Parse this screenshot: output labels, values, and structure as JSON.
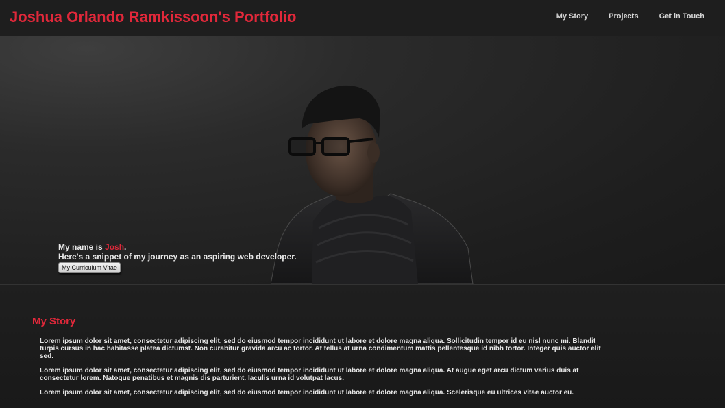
{
  "header": {
    "title": "Joshua Orlando Ramkissoon's Portfolio",
    "nav": [
      "My Story",
      "Projects",
      "Get in Touch"
    ]
  },
  "hero": {
    "intro_prefix": "My name is ",
    "intro_name": "Josh",
    "intro_suffix": ".",
    "tagline": "Here's a snippet of my journey as an aspiring web developer.",
    "cv_button": "My Curriculum Vitae"
  },
  "story": {
    "heading": "My Story",
    "paragraphs": [
      "Lorem ipsum dolor sit amet, consectetur adipiscing elit, sed do eiusmod tempor incididunt ut labore et dolore magna aliqua. Sollicitudin tempor id eu nisl nunc mi. Blandit turpis cursus in hac habitasse platea dictumst. Non curabitur gravida arcu ac tortor. At tellus at urna condimentum mattis pellentesque id nibh tortor. Integer quis auctor elit sed.",
      "Lorem ipsum dolor sit amet, consectetur adipiscing elit, sed do eiusmod tempor incididunt ut labore et dolore magna aliqua. At augue eget arcu dictum varius duis at consectetur lorem. Natoque penatibus et magnis dis parturient. Iaculis urna id volutpat lacus.",
      "Lorem ipsum dolor sit amet, consectetur adipiscing elit, sed do eiusmod tempor incididunt ut labore et dolore magna aliqua. Scelerisque eu ultrices vitae auctor eu."
    ]
  },
  "colors": {
    "accent": "#e0283a",
    "background": "#1b1b1b",
    "text": "#e6e6e6"
  }
}
